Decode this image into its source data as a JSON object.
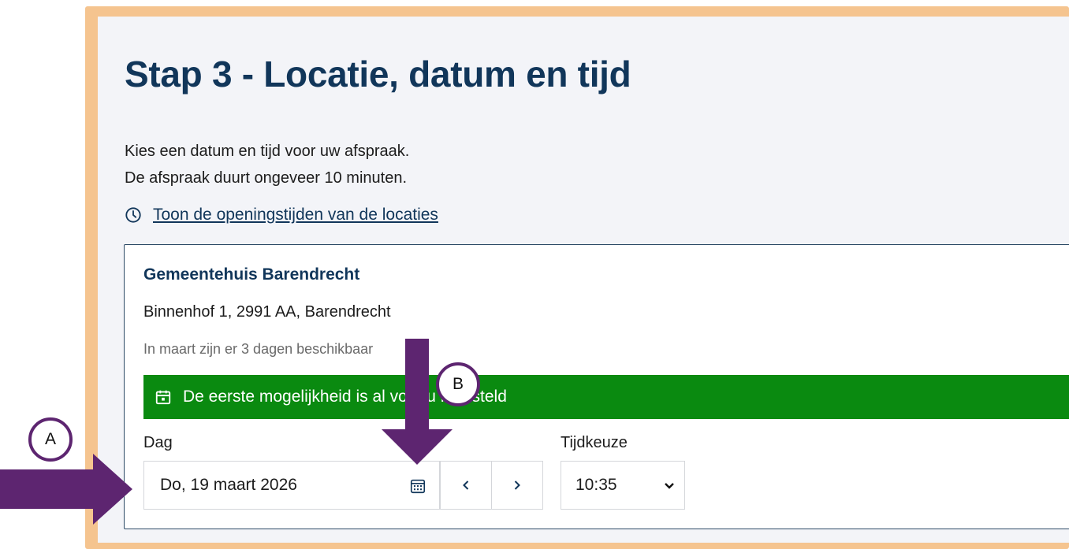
{
  "header": {
    "title": "Stap 3 - Locatie, datum en tijd"
  },
  "intro": {
    "line1": "Kies een datum en tijd voor uw afspraak.",
    "line2": "De afspraak duurt ongeveer 10 minuten."
  },
  "hours_link": {
    "label": "Toon de openingstijden van de locaties",
    "icon": "clock-icon"
  },
  "location": {
    "name": "Gemeentehuis Barendrecht",
    "address": "Binnenhof 1, 2991 AA, Barendrecht",
    "availability": "In maart zijn er 3 dagen beschikbaar",
    "banner": "De eerste mogelijkheid is al voor u ingesteld",
    "banner_icon": "calendar-icon"
  },
  "form": {
    "day_label": "Dag",
    "day_value": "Do, 19 maart 2026",
    "time_label": "Tijdkeuze",
    "time_value": "10:35",
    "prev_icon": "chevron-left-icon",
    "next_icon": "chevron-right-icon"
  },
  "annotations": {
    "a_label": "A",
    "b_label": "B"
  },
  "colors": {
    "frame": "#f5c48f",
    "page": "#f3f4f8",
    "heading": "#11365a",
    "banner": "#0a8a10",
    "annotation": "#5d2570"
  }
}
